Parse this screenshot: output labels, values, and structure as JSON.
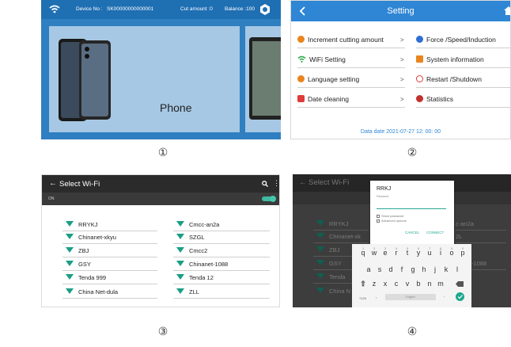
{
  "panel1": {
    "device_label": "Device No :",
    "device_no": "SK00000000000001",
    "cut_amount": "Cut amount :0",
    "balance": "Balance :100",
    "card_label": "Phone"
  },
  "panel2": {
    "title": "Setting",
    "left_items": [
      {
        "label": "Increment cutting amount",
        "arrow": ">",
        "color": "#e9851f"
      },
      {
        "label": "WiFi Setting",
        "arrow": ">",
        "color": "#2aa84a"
      },
      {
        "label": "Language setting",
        "arrow": ">",
        "color": "#e9851f"
      },
      {
        "label": "Date cleaning",
        "arrow": ">",
        "color": "#e03a3a"
      }
    ],
    "right_items": [
      {
        "label": "Force /Speed/Induction",
        "color": "#2f6fd4"
      },
      {
        "label": "System information",
        "color": "#e9851f"
      },
      {
        "label": "Restart /Shutdown",
        "color": "#e03a3a"
      },
      {
        "label": "Statistics",
        "color": "#c2302f"
      }
    ],
    "date": "Data date 2021-07-27 12:  00:  00"
  },
  "panel3": {
    "title": "Select Wi-Fi",
    "on_label": "ON",
    "networks_left": [
      "RRYKJ",
      "Chinanet-xkyu",
      "ZBJ",
      "GSY",
      "Tenda 999",
      "China Net-dula"
    ],
    "networks_right": [
      "Cmcc-an2a",
      "SZGL",
      "Cmcc2",
      "Chinanet-1088",
      "Tenda 12",
      "ZLL"
    ]
  },
  "panel4": {
    "title": "Select Wi-Fi",
    "dialog_title": "RRKJ",
    "password_label": "Password",
    "show_password": "Show password",
    "advanced": "Advanced options",
    "cancel": "CANCEL",
    "connect": "CONNECT",
    "networks_left": [
      "RRYKJ",
      "Chinanet-xk",
      "ZBJ",
      "GSY",
      "Tenda",
      "China N"
    ],
    "networks_right": [
      "c-an2a",
      "2L",
      "",
      "-1088",
      "",
      ""
    ],
    "row1": [
      "q",
      "w",
      "e",
      "r",
      "t",
      "y",
      "u",
      "i",
      "o",
      "p"
    ],
    "row1_nums": [
      "1",
      "2",
      "3",
      "4",
      "5",
      "6",
      "7",
      "8",
      "9",
      "0"
    ],
    "row2": [
      "a",
      "s",
      "d",
      "f",
      "g",
      "h",
      "j",
      "k",
      "l"
    ],
    "row3": [
      "z",
      "x",
      "c",
      "v",
      "b",
      "n",
      "m"
    ],
    "symbols_key": "?123",
    "comma_key": ",",
    "space_label": "English",
    "period_key": "."
  },
  "captions": [
    "①",
    "②",
    "③",
    "④"
  ]
}
